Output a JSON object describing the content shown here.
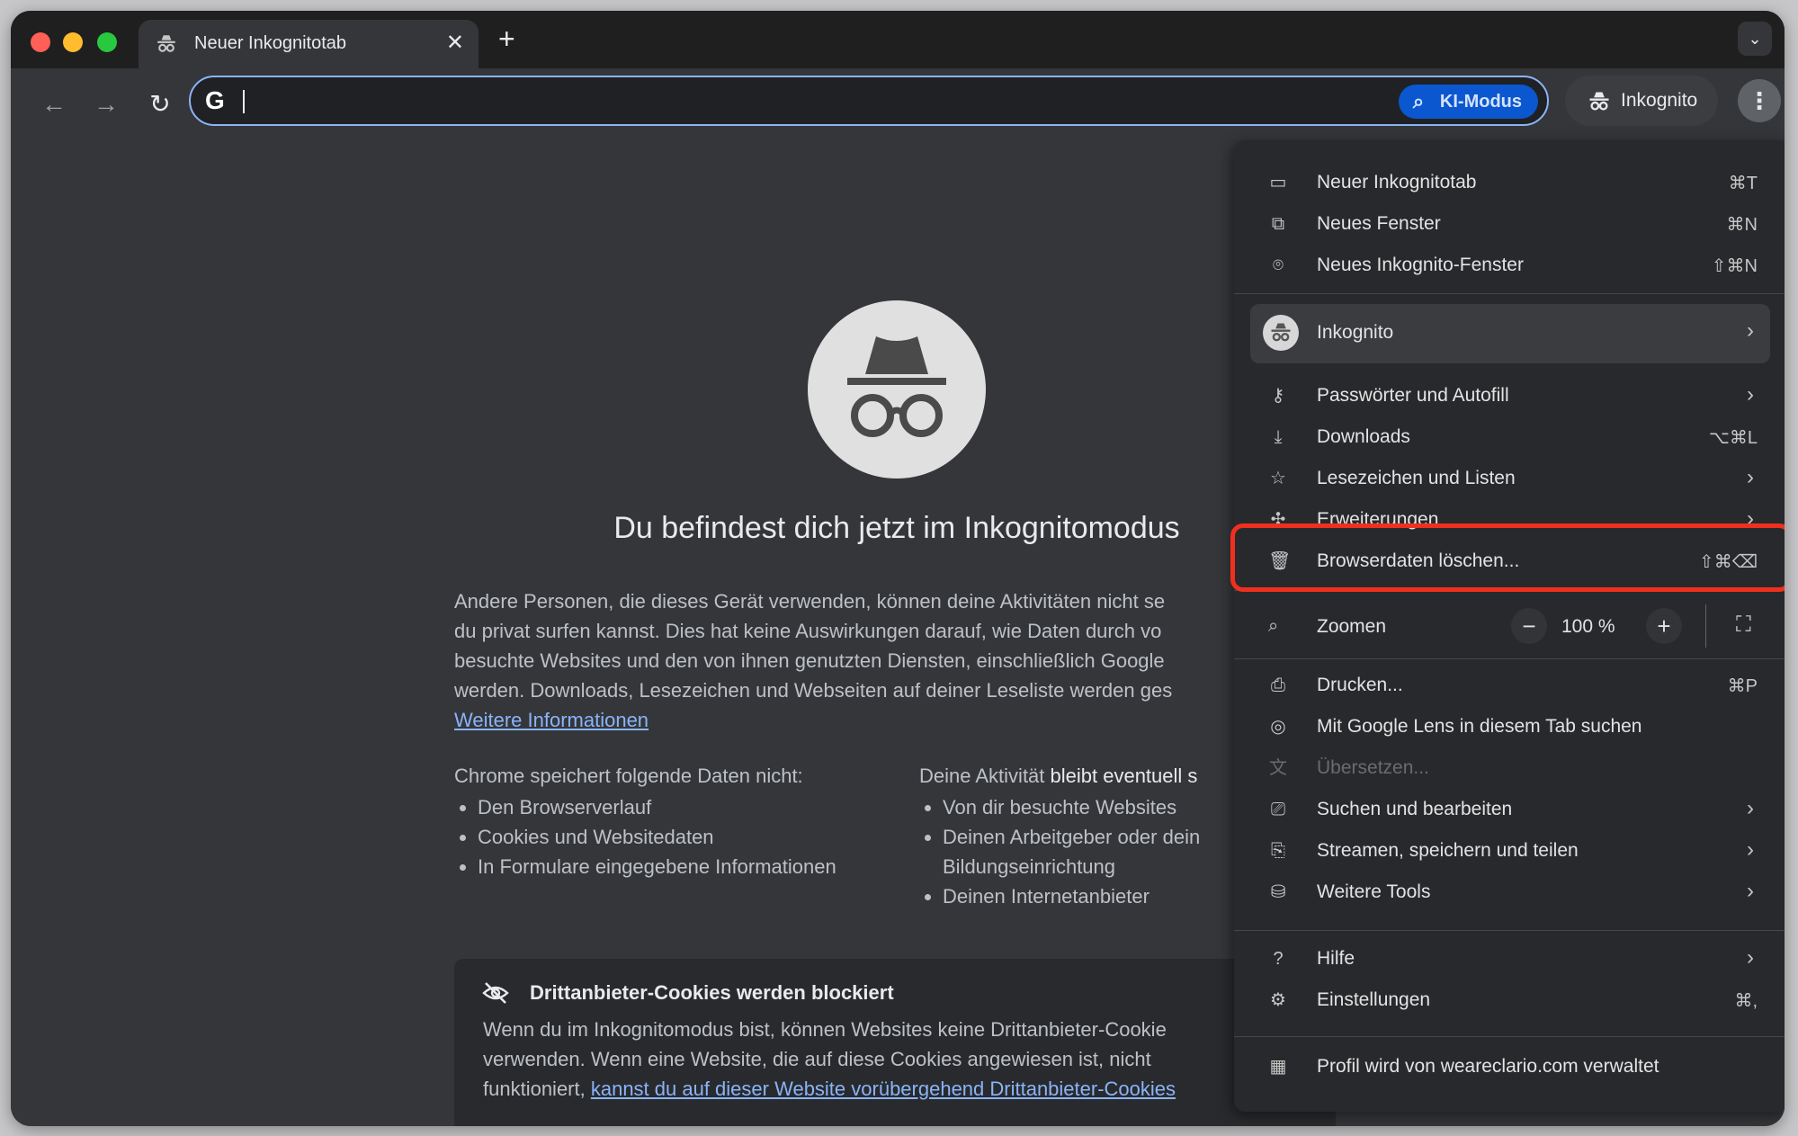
{
  "tab": {
    "title": "Neuer Inkognitotab",
    "close": "✕",
    "new_tab": "+",
    "tab_search": "⌄"
  },
  "toolbar": {
    "back": "←",
    "forward": "→",
    "reload": "↻",
    "omnibox_logo": "G",
    "ai_mode_label": "KI-Modus",
    "incognito_label": "Inkognito",
    "menu_icon": "⋮"
  },
  "page": {
    "headline": "Du befindest dich jetzt im Inkognitomodus",
    "paragraph_lines": [
      "Andere Personen, die dieses Gerät verwenden, können deine Aktivitäten nicht se",
      "du privat surfen kannst. Dies hat keine Auswirkungen darauf, wie Daten durch vo",
      "besuchte Websites und den von ihnen genutzten Diensten, einschließlich Google",
      "werden. Downloads, Lesezeichen und Webseiten auf deiner Leseliste werden ges"
    ],
    "more_info_link": "Weitere Informationen",
    "col1_title": "Chrome speichert folgende Daten nicht:",
    "col1_items": [
      "Den Browserverlauf",
      "Cookies und Websitedaten",
      "In Formulare eingegebene Informationen"
    ],
    "col2_title_prefix": "Deine Aktivität ",
    "col2_title_strong": "bleibt eventuell s",
    "col2_items": [
      "Von dir besuchte Websites",
      "Deinen Arbeitgeber oder dein",
      "Bildungseinrichtung",
      "Deinen Internetanbieter"
    ],
    "cookie_card": {
      "title": "Drittanbieter-Cookies werden blockiert",
      "line1": "Wenn du im Inkognitomodus bist, können Websites keine Drittanbieter-Cookie",
      "line2": "verwenden. Wenn eine Website, die auf diese Cookies angewiesen ist, nicht",
      "line3_prefix": "funktioniert, ",
      "line3_link": "kannst du auf dieser Website vorübergehend Drittanbieter-Cookies"
    }
  },
  "menu": {
    "group1": [
      {
        "icon": "tab-icon",
        "label": "Neuer Inkognitotab",
        "shortcut": "⌘T"
      },
      {
        "icon": "window-icon",
        "label": "Neues Fenster",
        "shortcut": "⌘N"
      },
      {
        "icon": "incognito-icon",
        "label": "Neues Inkognito-Fenster",
        "shortcut": "⇧⌘N"
      }
    ],
    "profile_label": "Inkognito",
    "group2": [
      {
        "icon": "key-icon",
        "label": "Passwörter und Autofill",
        "shortcut": ""
      },
      {
        "icon": "download-icon",
        "label": "Downloads",
        "shortcut": "⌥⌘L"
      },
      {
        "icon": "star-icon",
        "label": "Lesezeichen und Listen",
        "shortcut": ""
      },
      {
        "icon": "puzzle-icon",
        "label": "Erweiterungen",
        "shortcut": ""
      },
      {
        "icon": "trash-icon",
        "label": "Browserdaten löschen...",
        "shortcut": "⇧⌘⌫"
      }
    ],
    "zoom": {
      "label": "Zoomen",
      "minus": "−",
      "value": "100 %",
      "plus": "+",
      "fullscreen": "⛶"
    },
    "group3": [
      {
        "icon": "print-icon",
        "label": "Drucken...",
        "shortcut": "⌘P"
      },
      {
        "icon": "lens-icon",
        "label": "Mit Google Lens in diesem Tab suchen",
        "shortcut": ""
      },
      {
        "icon": "translate-icon",
        "label": "Übersetzen...",
        "shortcut": ""
      },
      {
        "icon": "find-icon",
        "label": "Suchen und bearbeiten",
        "shortcut": ""
      },
      {
        "icon": "cast-icon",
        "label": "Streamen, speichern und teilen",
        "shortcut": ""
      },
      {
        "icon": "toolbox-icon",
        "label": "Weitere Tools",
        "shortcut": ""
      }
    ],
    "group4": [
      {
        "icon": "help-icon",
        "label": "Hilfe",
        "shortcut": ""
      },
      {
        "icon": "gear-icon",
        "label": "Einstellungen",
        "shortcut": "⌘,"
      }
    ],
    "managed_label": "Profil wird von weareclario.com verwaltet",
    "arrow": "›"
  },
  "colors": {
    "highlight": "#f0301f",
    "accent": "#8ab4f8",
    "ai_button": "#0b57d0"
  }
}
